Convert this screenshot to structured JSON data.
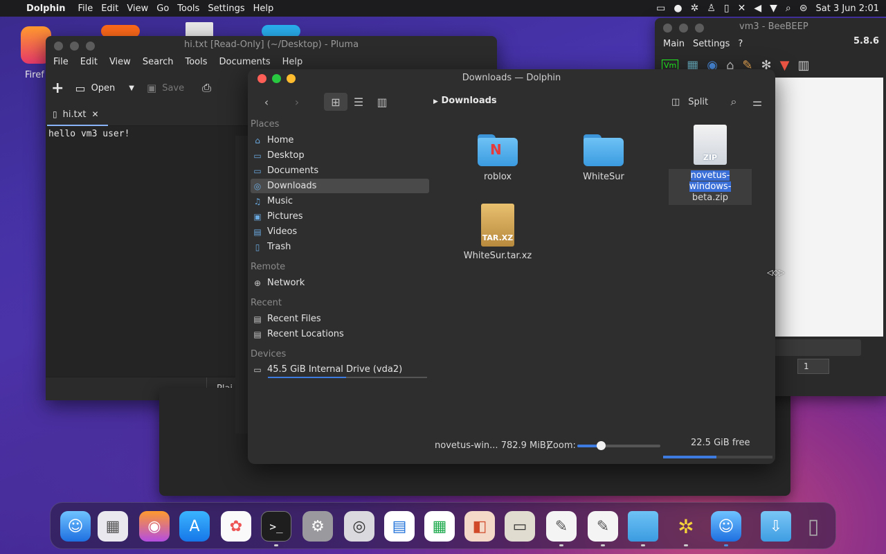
{
  "menubar": {
    "app_name": "Dolphin",
    "items": [
      "File",
      "Edit",
      "View",
      "Go",
      "Tools",
      "Settings",
      "Help"
    ],
    "clock": "Sat 3 Jun 2:01"
  },
  "desktop": {
    "firefox_label": "Firef"
  },
  "pluma": {
    "title": "hi.txt [Read-Only] (~/Desktop) - Pluma",
    "menu": [
      "File",
      "Edit",
      "View",
      "Search",
      "Tools",
      "Documents",
      "Help"
    ],
    "toolbar": {
      "open_label": "Open",
      "save_label": "Save"
    },
    "tab_label": "hi.txt",
    "content": "hello vm3 user!",
    "status_plain": "Plai"
  },
  "beebeep": {
    "title": "vm3 - BeeBEEP",
    "menu": [
      "Main",
      "Settings",
      "?"
    ],
    "version": "5.8.6",
    "badge": "1"
  },
  "dolphin": {
    "title": "Downloads — Dolphin",
    "breadcrumb": "Downloads",
    "split_label": "Split",
    "places_header": "Places",
    "places": [
      "Home",
      "Desktop",
      "Documents",
      "Downloads",
      "Music",
      "Pictures",
      "Videos",
      "Trash"
    ],
    "remote_header": "Remote",
    "remote": [
      "Network"
    ],
    "recent_header": "Recent",
    "recent": [
      "Recent Files",
      "Recent Locations"
    ],
    "devices_header": "Devices",
    "device": "45.5 GiB Internal Drive (vda2)",
    "device_usage_fraction": 0.49,
    "files": [
      {
        "name": "roblox",
        "type": "folder"
      },
      {
        "name": "WhiteSur",
        "type": "folder"
      },
      {
        "name_part1": "novetus-windows-",
        "name_part2": "beta.zip",
        "type": "zip",
        "badge": "ZIP"
      },
      {
        "name": "WhiteSur.tar.xz",
        "type": "tar",
        "badge": "TAR.XZ"
      }
    ],
    "status_text": "novetus-win... 782.9 MiB)",
    "zoom_label": "Zoom:",
    "zoom_fraction": 0.28,
    "free_label": "22.5 GiB free",
    "free_usage_fraction": 0.49
  },
  "colors": {
    "accent": "#3d7be0",
    "close": "#ff5f57",
    "minimize": "#28c840",
    "maximize": "#febc2e"
  }
}
